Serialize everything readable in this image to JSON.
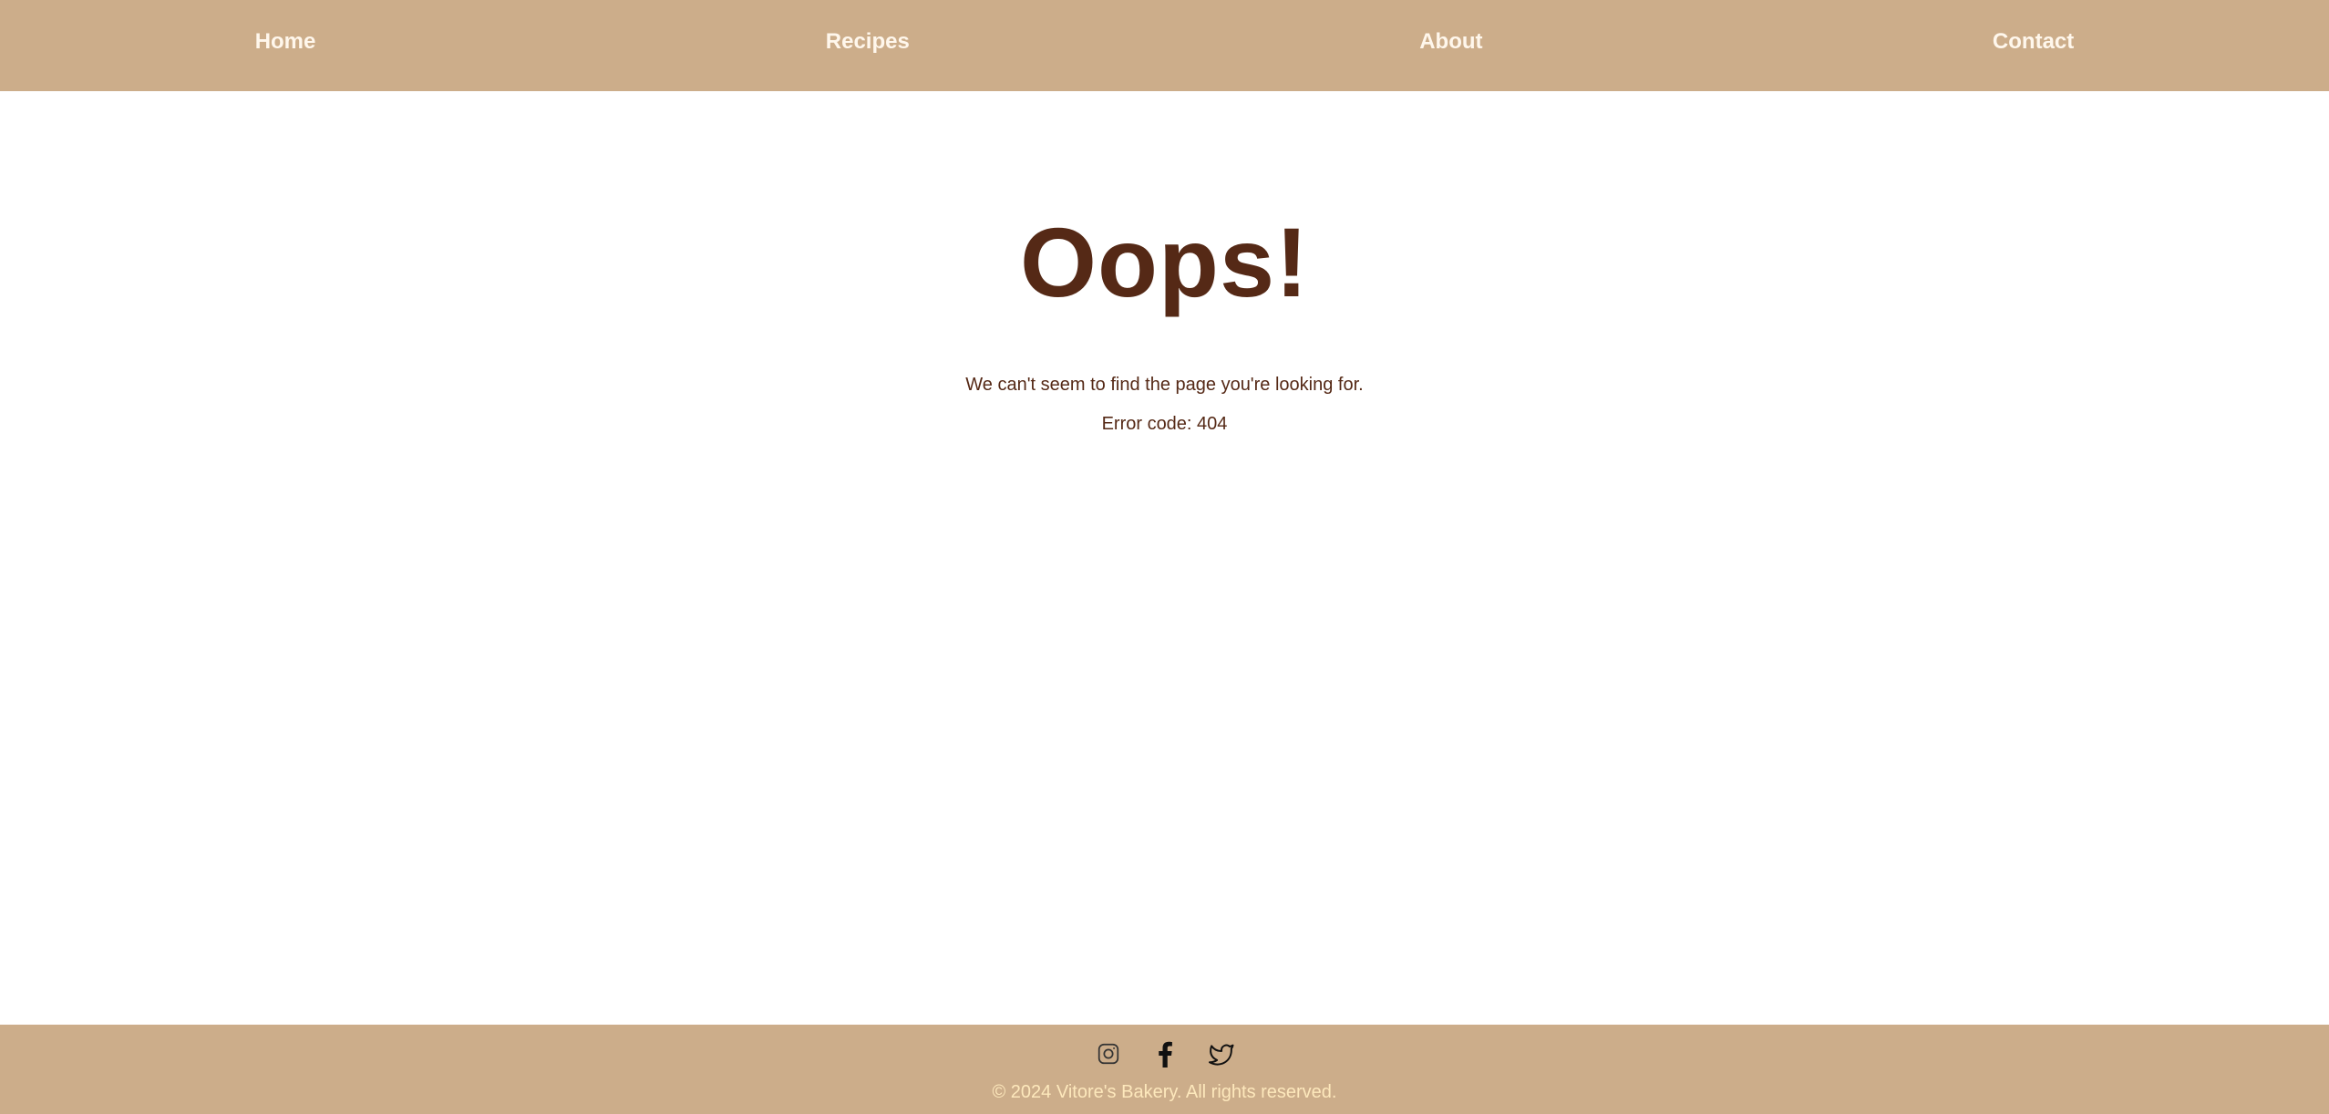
{
  "nav": {
    "items": [
      {
        "label": "Home"
      },
      {
        "label": "Recipes"
      },
      {
        "label": "About"
      },
      {
        "label": "Contact"
      }
    ]
  },
  "main": {
    "title": "Oops!",
    "message": "We can't seem to find the page you're looking for.",
    "error_code": "Error code: 404"
  },
  "footer": {
    "social": [
      {
        "icon": "instagram-icon"
      },
      {
        "icon": "facebook-icon"
      },
      {
        "icon": "twitter-icon"
      }
    ],
    "copyright": "© 2024 Vitore's Bakery. All rights reserved."
  },
  "colors": {
    "bar_background": "#ccad8a",
    "nav_text": "#fff7ec",
    "heading_text": "#552916",
    "footer_text": "#fde8bc"
  }
}
